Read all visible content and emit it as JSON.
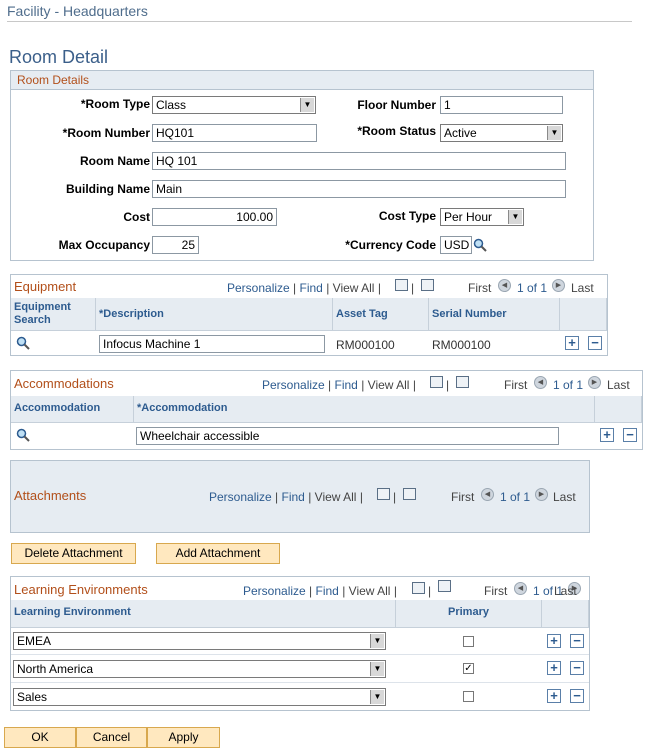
{
  "header": {
    "breadcrumb": "Facility - Headquarters",
    "page_title": "Room Detail"
  },
  "room_details": {
    "title": "Room Details",
    "room_type_label": "*Room Type",
    "room_type": "Class",
    "floor_number_label": "Floor Number",
    "floor_number": "1",
    "room_number_label": "*Room Number",
    "room_number": "HQ101",
    "room_status_label": "*Room Status",
    "room_status": "Active",
    "room_name_label": "Room Name",
    "room_name": "HQ 101",
    "building_name_label": "Building Name",
    "building_name": "Main",
    "cost_label": "Cost",
    "cost": "100.00",
    "cost_type_label": "Cost Type",
    "cost_type": "Per Hour",
    "max_occupancy_label": "Max Occupancy",
    "max_occupancy": "25",
    "currency_code_label": "*Currency Code",
    "currency_code": "USD"
  },
  "grid_nav": {
    "personalize": "Personalize",
    "find": "Find",
    "sep": "|",
    "view_all": "View All",
    "first": "First",
    "last": "Last",
    "range": "1 of 1"
  },
  "equipment": {
    "title": "Equipment",
    "col_search_1": "Equipment",
    "col_search_2": "Search",
    "col_description": "*Description",
    "col_asset_tag": "Asset Tag",
    "col_serial": "Serial Number",
    "rows": [
      {
        "description": "Infocus Machine 1",
        "asset_tag": "RM000100",
        "serial": "RM000100"
      }
    ]
  },
  "accommodations": {
    "title": "Accommodations",
    "col_accommodation": "Accommodation",
    "col_accommodation_req": "*Accommodation",
    "rows": [
      {
        "accommodation": "Wheelchair accessible"
      }
    ]
  },
  "attachments": {
    "title": "Attachments"
  },
  "buttons": {
    "delete_attachment": "Delete Attachment",
    "add_attachment": "Add Attachment",
    "ok": "OK",
    "cancel": "Cancel",
    "apply": "Apply"
  },
  "learning_env": {
    "title": "Learning Environments",
    "col_env": "Learning Environment",
    "col_primary": "Primary",
    "rows": [
      {
        "env": "EMEA",
        "primary": false
      },
      {
        "env": "North America",
        "primary": true
      },
      {
        "env": "Sales",
        "primary": false
      }
    ]
  },
  "symbols": {
    "add": "+",
    "remove": "−",
    "check": "✓",
    "left": "◀",
    "right": "▶",
    "dropdown": "▼"
  }
}
